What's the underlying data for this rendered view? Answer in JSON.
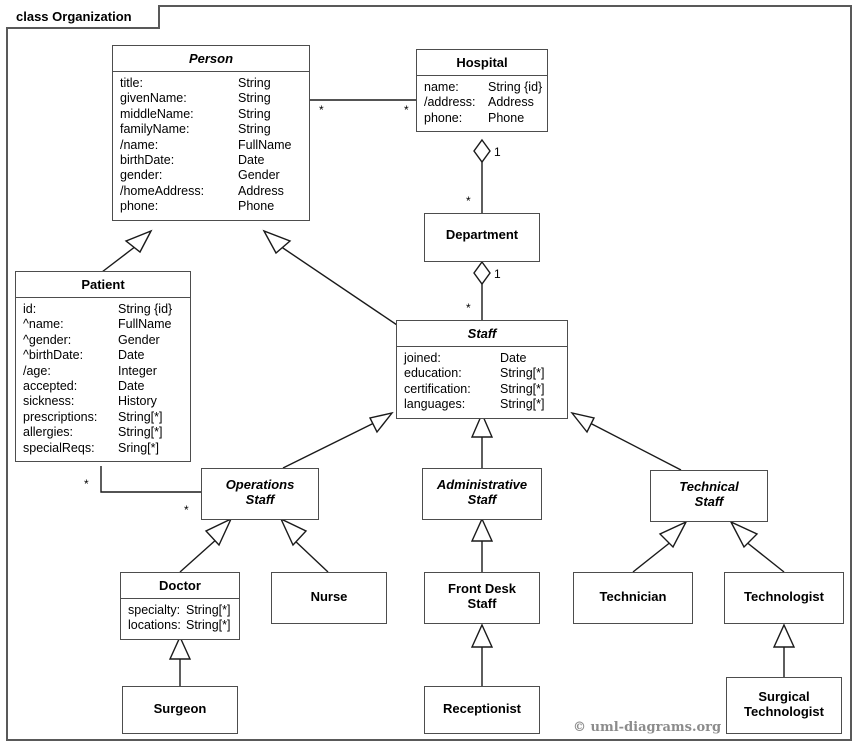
{
  "diagram": {
    "frame_label": "class Organization",
    "credit": "© uml-diagrams.org"
  },
  "classes": {
    "person": {
      "name": "Person",
      "abstract": true,
      "attributes": [
        {
          "name": "title:",
          "type": "String"
        },
        {
          "name": "givenName:",
          "type": "String"
        },
        {
          "name": "middleName:",
          "type": "String"
        },
        {
          "name": "familyName:",
          "type": "String"
        },
        {
          "name": "/name:",
          "type": "FullName"
        },
        {
          "name": "birthDate:",
          "type": "Date"
        },
        {
          "name": "gender:",
          "type": "Gender"
        },
        {
          "name": "/homeAddress:",
          "type": "Address"
        },
        {
          "name": "phone:",
          "type": "Phone"
        }
      ]
    },
    "hospital": {
      "name": "Hospital",
      "abstract": false,
      "attributes": [
        {
          "name": "name:",
          "type": "String {id}"
        },
        {
          "name": "/address:",
          "type": "Address"
        },
        {
          "name": "phone:",
          "type": "Phone"
        }
      ]
    },
    "patient": {
      "name": "Patient",
      "abstract": false,
      "attributes": [
        {
          "name": "id:",
          "type": "String {id}"
        },
        {
          "name": "^name:",
          "type": "FullName"
        },
        {
          "name": "^gender:",
          "type": "Gender"
        },
        {
          "name": "^birthDate:",
          "type": "Date"
        },
        {
          "name": "/age:",
          "type": "Integer"
        },
        {
          "name": "accepted:",
          "type": "Date"
        },
        {
          "name": "sickness:",
          "type": "History"
        },
        {
          "name": "prescriptions:",
          "type": "String[*]"
        },
        {
          "name": "allergies:",
          "type": "String[*]"
        },
        {
          "name": "specialReqs:",
          "type": "Sring[*]"
        }
      ]
    },
    "department": {
      "name": "Department",
      "abstract": false,
      "attributes": []
    },
    "staff": {
      "name": "Staff",
      "abstract": true,
      "attributes": [
        {
          "name": "joined:",
          "type": "Date"
        },
        {
          "name": "education:",
          "type": "String[*]"
        },
        {
          "name": "certification:",
          "type": "String[*]"
        },
        {
          "name": "languages:",
          "type": "String[*]"
        }
      ]
    },
    "operations_staff": {
      "name": "Operations\nStaff",
      "abstract": true,
      "attributes": []
    },
    "administrative_staff": {
      "name": "Administrative\nStaff",
      "abstract": true,
      "attributes": []
    },
    "technical_staff": {
      "name": "Technical\nStaff",
      "abstract": true,
      "attributes": []
    },
    "doctor": {
      "name": "Doctor",
      "abstract": false,
      "attributes": [
        {
          "name": "specialty:",
          "type": "String[*]"
        },
        {
          "name": "locations:",
          "type": "String[*]"
        }
      ]
    },
    "nurse": {
      "name": "Nurse",
      "abstract": false,
      "attributes": []
    },
    "front_desk_staff": {
      "name": "Front Desk\nStaff",
      "abstract": false,
      "attributes": []
    },
    "technician": {
      "name": "Technician",
      "abstract": false,
      "attributes": []
    },
    "technologist": {
      "name": "Technologist",
      "abstract": false,
      "attributes": []
    },
    "surgeon": {
      "name": "Surgeon",
      "abstract": false,
      "attributes": []
    },
    "receptionist": {
      "name": "Receptionist",
      "abstract": false,
      "attributes": []
    },
    "surgical_technologist": {
      "name": "Surgical\nTechnologist",
      "abstract": false,
      "attributes": []
    }
  },
  "multiplicities": {
    "person_hospital_person_end": "*",
    "person_hospital_hospital_end": "*",
    "hospital_department_hospital_end": "1",
    "hospital_department_department_end": "*",
    "department_staff_department_end": "1",
    "department_staff_staff_end": "*",
    "patient_operations_patient_end": "*",
    "patient_operations_operations_end": "*"
  },
  "chart_data": {
    "type": "diagram",
    "notation": "UML class diagram",
    "nodes": [
      "Person",
      "Hospital",
      "Patient",
      "Department",
      "Staff",
      "Operations Staff",
      "Administrative Staff",
      "Technical Staff",
      "Doctor",
      "Nurse",
      "Front Desk Staff",
      "Technician",
      "Technologist",
      "Surgeon",
      "Receptionist",
      "Surgical Technologist"
    ],
    "relationships": [
      {
        "kind": "association",
        "from": "Person",
        "to": "Hospital",
        "from_mult": "*",
        "to_mult": "*"
      },
      {
        "kind": "aggregation",
        "whole": "Hospital",
        "part": "Department",
        "whole_mult": "1",
        "part_mult": "*"
      },
      {
        "kind": "aggregation",
        "whole": "Department",
        "part": "Staff",
        "whole_mult": "1",
        "part_mult": "*"
      },
      {
        "kind": "association",
        "from": "Patient",
        "to": "Operations Staff",
        "from_mult": "*",
        "to_mult": "*"
      },
      {
        "kind": "generalization",
        "child": "Patient",
        "parent": "Person"
      },
      {
        "kind": "generalization",
        "child": "Staff",
        "parent": "Person"
      },
      {
        "kind": "generalization",
        "child": "Operations Staff",
        "parent": "Staff"
      },
      {
        "kind": "generalization",
        "child": "Administrative Staff",
        "parent": "Staff"
      },
      {
        "kind": "generalization",
        "child": "Technical Staff",
        "parent": "Staff"
      },
      {
        "kind": "generalization",
        "child": "Doctor",
        "parent": "Operations Staff"
      },
      {
        "kind": "generalization",
        "child": "Nurse",
        "parent": "Operations Staff"
      },
      {
        "kind": "generalization",
        "child": "Front Desk Staff",
        "parent": "Administrative Staff"
      },
      {
        "kind": "generalization",
        "child": "Technician",
        "parent": "Technical Staff"
      },
      {
        "kind": "generalization",
        "child": "Technologist",
        "parent": "Technical Staff"
      },
      {
        "kind": "generalization",
        "child": "Surgeon",
        "parent": "Doctor"
      },
      {
        "kind": "generalization",
        "child": "Receptionist",
        "parent": "Front Desk Staff"
      },
      {
        "kind": "generalization",
        "child": "Surgical Technologist",
        "parent": "Technologist"
      }
    ]
  }
}
